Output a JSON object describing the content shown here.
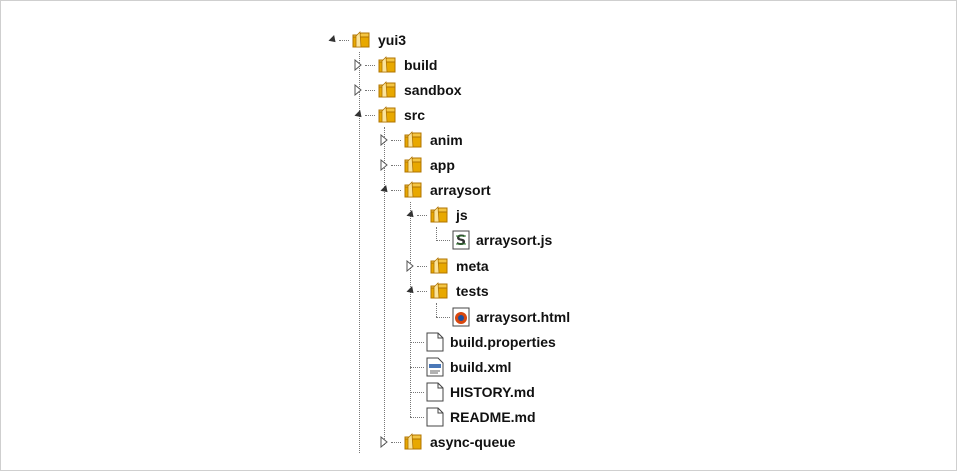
{
  "tree": {
    "root": {
      "label": "yui3",
      "expanded": true
    },
    "items": [
      {
        "label": "build",
        "type": "folder",
        "expanded": false
      },
      {
        "label": "sandbox",
        "type": "folder",
        "expanded": false
      },
      {
        "label": "src",
        "type": "folder",
        "expanded": true
      },
      {
        "label": "anim",
        "type": "folder",
        "expanded": false
      },
      {
        "label": "app",
        "type": "folder",
        "expanded": false
      },
      {
        "label": "arraysort",
        "type": "folder",
        "expanded": true
      },
      {
        "label": "js",
        "type": "folder",
        "expanded": true
      },
      {
        "label": "arraysort.js",
        "type": "js-file"
      },
      {
        "label": "meta",
        "type": "folder",
        "expanded": false
      },
      {
        "label": "tests",
        "type": "folder",
        "expanded": true
      },
      {
        "label": "arraysort.html",
        "type": "html-file"
      },
      {
        "label": "build.properties",
        "type": "file"
      },
      {
        "label": "build.xml",
        "type": "xml-file"
      },
      {
        "label": "HISTORY.md",
        "type": "file"
      },
      {
        "label": "README.md",
        "type": "file"
      },
      {
        "label": "async-queue",
        "type": "folder",
        "expanded": false
      }
    ]
  },
  "colors": {
    "folder": "#e8a800",
    "folder_dark": "#b07400",
    "line": "#777777"
  }
}
